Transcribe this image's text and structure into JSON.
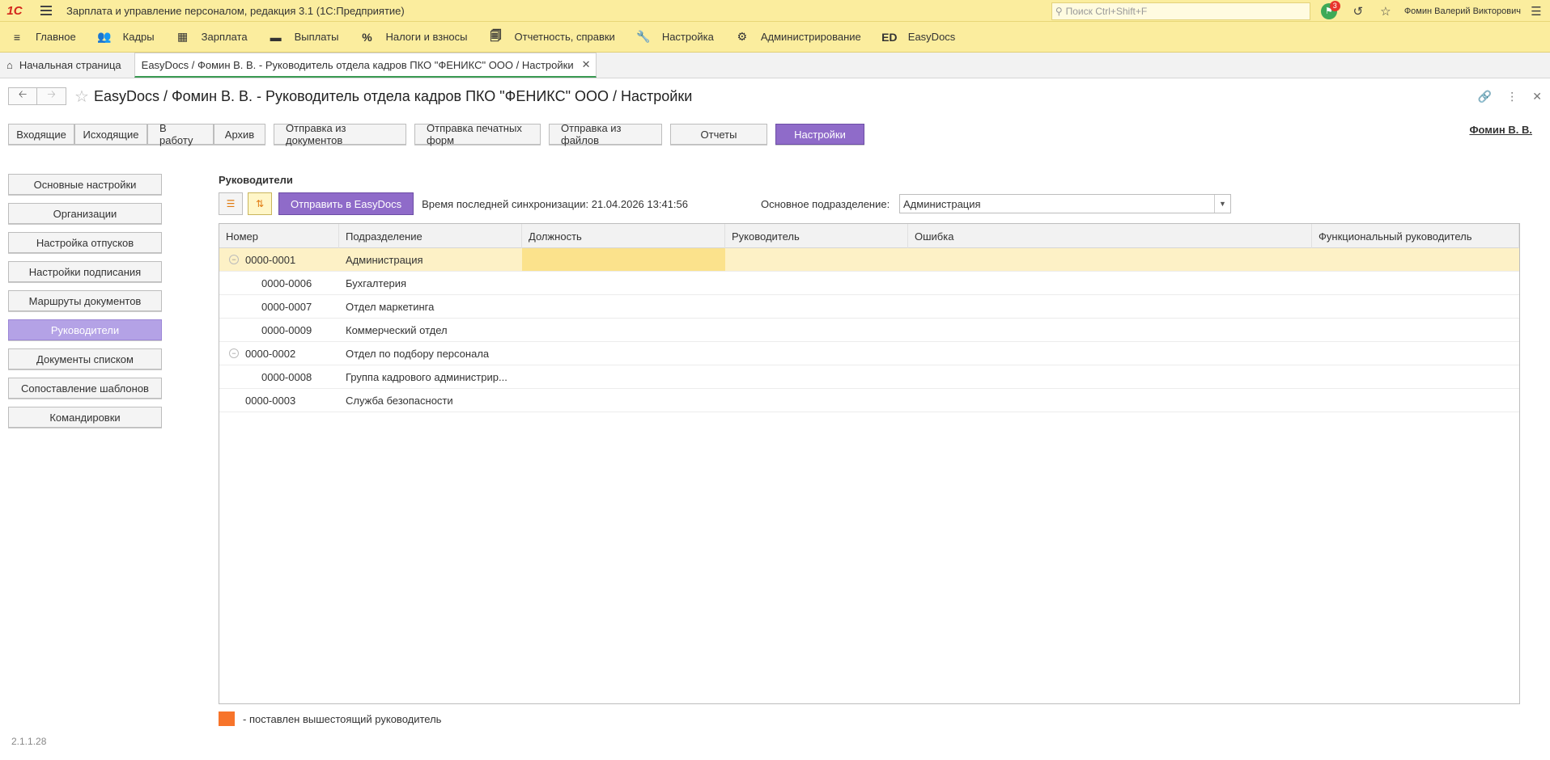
{
  "app": {
    "title": "Зарплата и управление персоналом, редакция 3.1  (1С:Предприятие)",
    "logo_text": "1С",
    "search_placeholder": "Поиск Ctrl+Shift+F",
    "notifications_count": "3",
    "user": "Фомин Валерий Викторович"
  },
  "sections": [
    {
      "label": "Главное",
      "icon": "menu-icon"
    },
    {
      "label": "Кадры",
      "icon": "people-icon"
    },
    {
      "label": "Зарплата",
      "icon": "calculator-icon"
    },
    {
      "label": "Выплаты",
      "icon": "wallet-icon"
    },
    {
      "label": "Налоги и взносы",
      "icon": "percent-icon"
    },
    {
      "label": "Отчетность, справки",
      "icon": "documents-icon"
    },
    {
      "label": "Настройка",
      "icon": "wrench-icon"
    },
    {
      "label": "Администрирование",
      "icon": "gear-icon"
    },
    {
      "label": "EasyDocs",
      "icon": "ed-icon",
      "icon_text": "ED"
    }
  ],
  "tabs": {
    "home": "Начальная страница",
    "active": "EasyDocs / Фомин В. В. - Руководитель отдела кадров ПКО \"ФЕНИКС\" ООО / Настройки"
  },
  "form": {
    "title": "EasyDocs / Фомин В. В. - Руководитель отдела кадров ПКО \"ФЕНИКС\" ООО / Настройки",
    "user_link": "Фомин В. В."
  },
  "top_buttons": [
    {
      "label": "Входящие",
      "active": false
    },
    {
      "label": "Исходящие",
      "active": false
    },
    {
      "label": "В работу",
      "active": false
    },
    {
      "label": "Архив",
      "active": false
    },
    {
      "label": "Отправка из документов",
      "active": false
    },
    {
      "label": "Отправка печатных форм",
      "active": false
    },
    {
      "label": "Отправка из файлов",
      "active": false
    },
    {
      "label": "Отчеты",
      "active": false
    },
    {
      "label": "Настройки",
      "active": true
    }
  ],
  "left_menu": [
    {
      "label": "Основные настройки",
      "active": false
    },
    {
      "label": "Организации",
      "active": false
    },
    {
      "label": "Настройка отпусков",
      "active": false
    },
    {
      "label": "Настройки подписания",
      "active": false
    },
    {
      "label": "Маршруты документов",
      "active": false
    },
    {
      "label": "Руководители",
      "active": true
    },
    {
      "label": "Документы списком",
      "active": false
    },
    {
      "label": "Сопоставление шаблонов",
      "active": false
    },
    {
      "label": "Командировки",
      "active": false
    }
  ],
  "main": {
    "section_title": "Руководители",
    "send_button": "Отправить в EasyDocs",
    "sync_text": "Время последней синхронизации: 21.04.2026 13:41:56",
    "dept_label": "Основное подразделение:",
    "dept_value": "Администрация"
  },
  "grid": {
    "columns": [
      "Номер",
      "Подразделение",
      "Должность",
      "Руководитель",
      "Ошибка",
      "Функциональный руководитель"
    ],
    "rows": [
      {
        "number": "0000-0001",
        "dept": "Администрация",
        "level": 0,
        "expander": true,
        "selected": true
      },
      {
        "number": "0000-0006",
        "dept": "Бухгалтерия",
        "level": 1,
        "expander": false,
        "selected": false
      },
      {
        "number": "0000-0007",
        "dept": "Отдел маркетинга",
        "level": 1,
        "expander": false,
        "selected": false
      },
      {
        "number": "0000-0009",
        "dept": "Коммерческий отдел",
        "level": 1,
        "expander": false,
        "selected": false
      },
      {
        "number": "0000-0002",
        "dept": "Отдел по подбору персонала",
        "level": 0,
        "expander": true,
        "selected": false
      },
      {
        "number": "0000-0008",
        "dept": "Группа кадрового администрир...",
        "level": 1,
        "expander": false,
        "selected": false
      },
      {
        "number": "0000-0003",
        "dept": "Служба безопасности",
        "level": 0,
        "expander": false,
        "selected": false
      }
    ]
  },
  "legend": {
    "text": "- поставлен вышестоящий руководитель",
    "color": "#f7742a"
  },
  "version": "2.1.1.28"
}
